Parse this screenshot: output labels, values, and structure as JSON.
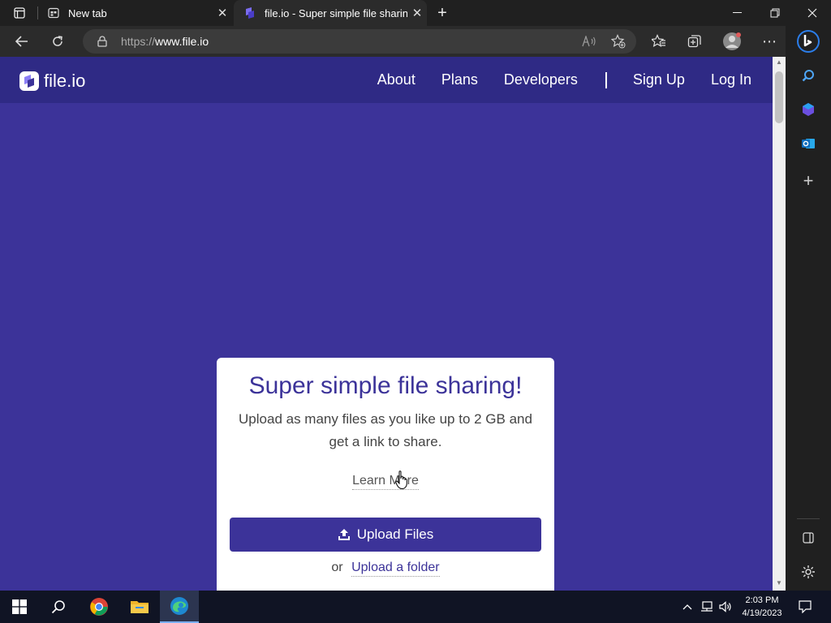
{
  "browser": {
    "tabs": [
      {
        "title": "New tab",
        "active": false
      },
      {
        "title": "file.io - Super simple file sharing",
        "active": true
      }
    ],
    "address_bar": {
      "url_prefix": "https://",
      "url_host": "www.file.io"
    }
  },
  "site": {
    "logo_text": "file.io",
    "nav": {
      "about": "About",
      "plans": "Plans",
      "developers": "Developers",
      "signup": "Sign Up",
      "login": "Log In"
    },
    "card": {
      "heading": "Super simple file sharing!",
      "subtitle": "Upload as many files as you like up to 2 GB and get a link to share.",
      "learn_more": "Learn More",
      "upload_button": "Upload Files",
      "or_text": "or",
      "upload_folder": "Upload a folder"
    }
  },
  "taskbar": {
    "time": "2:03 PM",
    "date": "4/19/2023"
  },
  "colors": {
    "brand_purple": "#3c3399",
    "header_purple": "#2f2a85"
  }
}
